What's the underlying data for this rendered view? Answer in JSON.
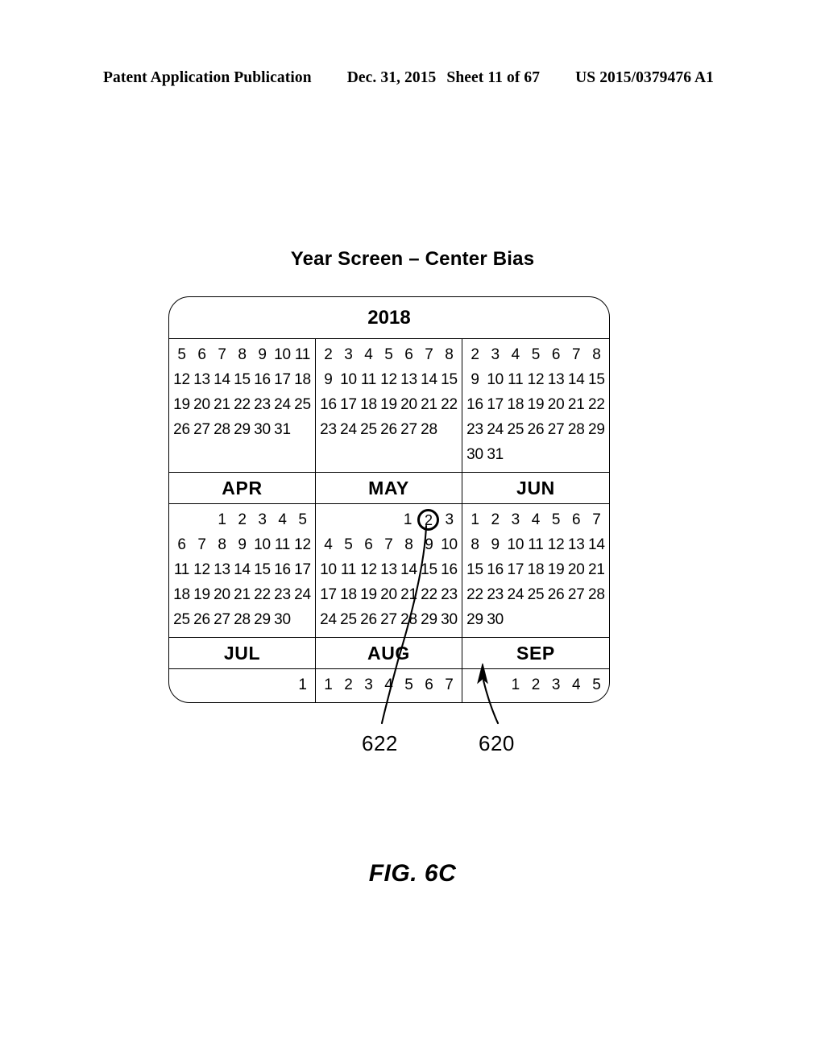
{
  "header": {
    "publication": "Patent Application Publication",
    "date": "Dec. 31, 2015",
    "sheet": "Sheet 11 of 67",
    "patent_number": "US 2015/0379476 A1"
  },
  "figure": {
    "title": "Year Screen – Center Bias",
    "caption": "FIG. 6C"
  },
  "calendar": {
    "year": "2018",
    "rows": [
      {
        "columns": [
          {
            "weeks": [
              [
                "5",
                "6",
                "7",
                "8",
                "9",
                "10",
                "11"
              ],
              [
                "12",
                "13",
                "14",
                "15",
                "16",
                "17",
                "18"
              ],
              [
                "19",
                "20",
                "21",
                "22",
                "23",
                "24",
                "25"
              ],
              [
                "26",
                "27",
                "28",
                "29",
                "30",
                "31",
                ""
              ],
              [
                "",
                "",
                "",
                "",
                "",
                "",
                ""
              ]
            ]
          },
          {
            "weeks": [
              [
                "2",
                "3",
                "4",
                "5",
                "6",
                "7",
                "8"
              ],
              [
                "9",
                "10",
                "11",
                "12",
                "13",
                "14",
                "15"
              ],
              [
                "16",
                "17",
                "18",
                "19",
                "20",
                "21",
                "22"
              ],
              [
                "23",
                "24",
                "25",
                "26",
                "27",
                "28",
                ""
              ],
              [
                "",
                "",
                "",
                "",
                "",
                "",
                ""
              ]
            ]
          },
          {
            "weeks": [
              [
                "2",
                "3",
                "4",
                "5",
                "6",
                "7",
                "8"
              ],
              [
                "9",
                "10",
                "11",
                "12",
                "13",
                "14",
                "15"
              ],
              [
                "16",
                "17",
                "18",
                "19",
                "20",
                "21",
                "22"
              ],
              [
                "23",
                "24",
                "25",
                "26",
                "27",
                "28",
                "29"
              ],
              [
                "30",
                "31",
                "",
                "",
                "",
                "",
                ""
              ]
            ]
          }
        ]
      },
      {
        "month_labels": [
          "APR",
          "MAY",
          "JUN"
        ],
        "columns": [
          {
            "weeks": [
              [
                "",
                "",
                "1",
                "2",
                "3",
                "4",
                "5"
              ],
              [
                "6",
                "7",
                "8",
                "9",
                "10",
                "11",
                "12"
              ],
              [
                "11",
                "12",
                "13",
                "14",
                "15",
                "16",
                "17"
              ],
              [
                "18",
                "19",
                "20",
                "21",
                "22",
                "23",
                "24"
              ],
              [
                "25",
                "26",
                "27",
                "28",
                "29",
                "30",
                ""
              ]
            ]
          },
          {
            "weeks": [
              [
                "",
                "",
                "",
                "",
                "1",
                "2",
                "3"
              ],
              [
                "4",
                "5",
                "6",
                "7",
                "8",
                "9",
                "10"
              ],
              [
                "10",
                "11",
                "12",
                "13",
                "14",
                "15",
                "16"
              ],
              [
                "17",
                "18",
                "19",
                "20",
                "21",
                "22",
                "23"
              ],
              [
                "24",
                "25",
                "26",
                "27",
                "28",
                "29",
                "30"
              ]
            ],
            "selected": {
              "week": 0,
              "index": 5,
              "value": "2"
            }
          },
          {
            "weeks": [
              [
                "1",
                "2",
                "3",
                "4",
                "5",
                "6",
                "7"
              ],
              [
                "8",
                "9",
                "10",
                "11",
                "12",
                "13",
                "14"
              ],
              [
                "15",
                "16",
                "17",
                "18",
                "19",
                "20",
                "21"
              ],
              [
                "22",
                "23",
                "24",
                "25",
                "26",
                "27",
                "28"
              ],
              [
                "29",
                "30",
                "",
                "",
                "",
                "",
                ""
              ]
            ]
          }
        ]
      },
      {
        "month_labels": [
          "JUL",
          "AUG",
          "SEP"
        ],
        "columns": [
          {
            "weeks": [
              [
                "",
                "",
                "",
                "",
                "",
                "",
                "1"
              ]
            ]
          },
          {
            "weeks": [
              [
                "1",
                "2",
                "3",
                "4",
                "5",
                "6",
                "7"
              ]
            ]
          },
          {
            "weeks": [
              [
                "",
                "",
                "1",
                "2",
                "3",
                "4",
                "5"
              ]
            ]
          }
        ]
      }
    ]
  },
  "callouts": {
    "ref_622": "622",
    "ref_620": "620"
  }
}
